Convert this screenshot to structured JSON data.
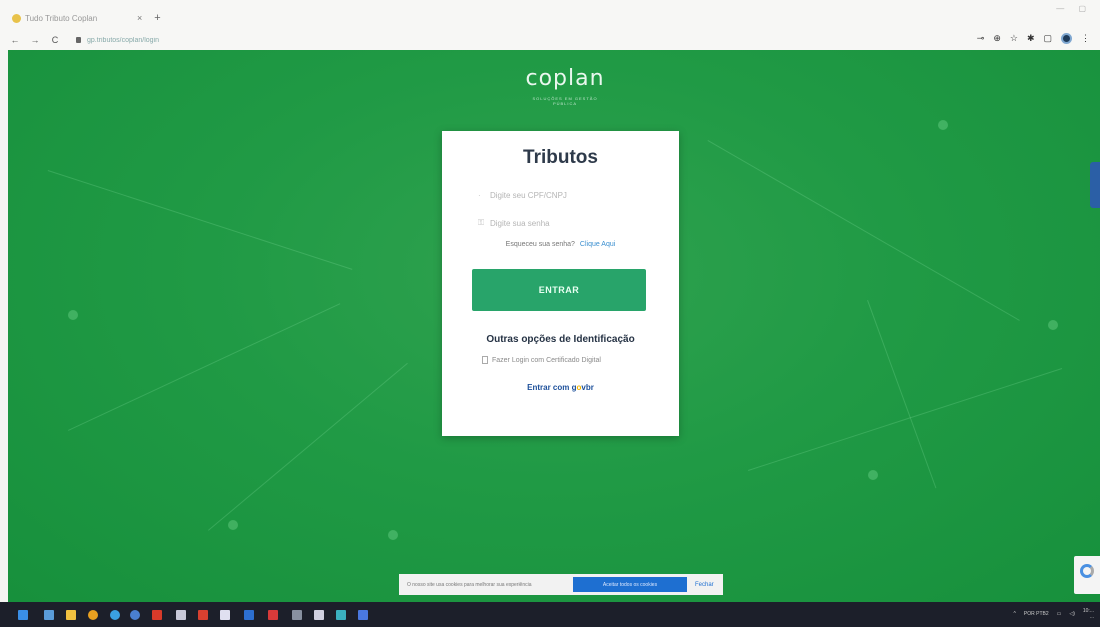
{
  "browser": {
    "tab_title": "Tudo Tributo Coplan",
    "tab_close": "×",
    "tab_new": "+",
    "url": "gp.tributos/coplan/login",
    "nav": {
      "back": "←",
      "forward": "→",
      "reload": "C"
    }
  },
  "page": {
    "logo_text": "coplan",
    "logo_sub": "SOLUÇÕES EM GESTÃO PÚBLICA",
    "card": {
      "title": "Tributos",
      "login_placeholder": "Digite seu CPF/CNPJ",
      "password_placeholder": "Digite sua senha",
      "forgot_text": "Esqueceu sua senha?",
      "forgot_link": "Clique Aqui",
      "submit_label": "ENTRAR",
      "other_options_title": "Outras opções de Identificação",
      "certificate_label": "Fazer Login com Certificado Digital",
      "govbr_prefix": "Entrar com",
      "govbr_g": "g",
      "govbr_o": "o",
      "govbr_rest": "vbr"
    }
  },
  "cookie_bar": {
    "text": "O nosso site usa cookies para melhorar sua experiência",
    "accept_label": "Aceitar todos os cookies",
    "close_label": "Fechar"
  },
  "taskbar": {
    "clock_time": "10:...",
    "clock_date": "...",
    "lang": "POR PTB2"
  },
  "colors": {
    "background_green": "#209a45",
    "button_green": "#28a46a",
    "govbr_blue": "#1c4f9a",
    "govbr_yellow": "#f2b600"
  },
  "icons": [
    "star-icon",
    "extension-icon",
    "profile-icon",
    "user-icon",
    "lock-icon",
    "certificate-icon",
    "recaptcha-icon"
  ]
}
